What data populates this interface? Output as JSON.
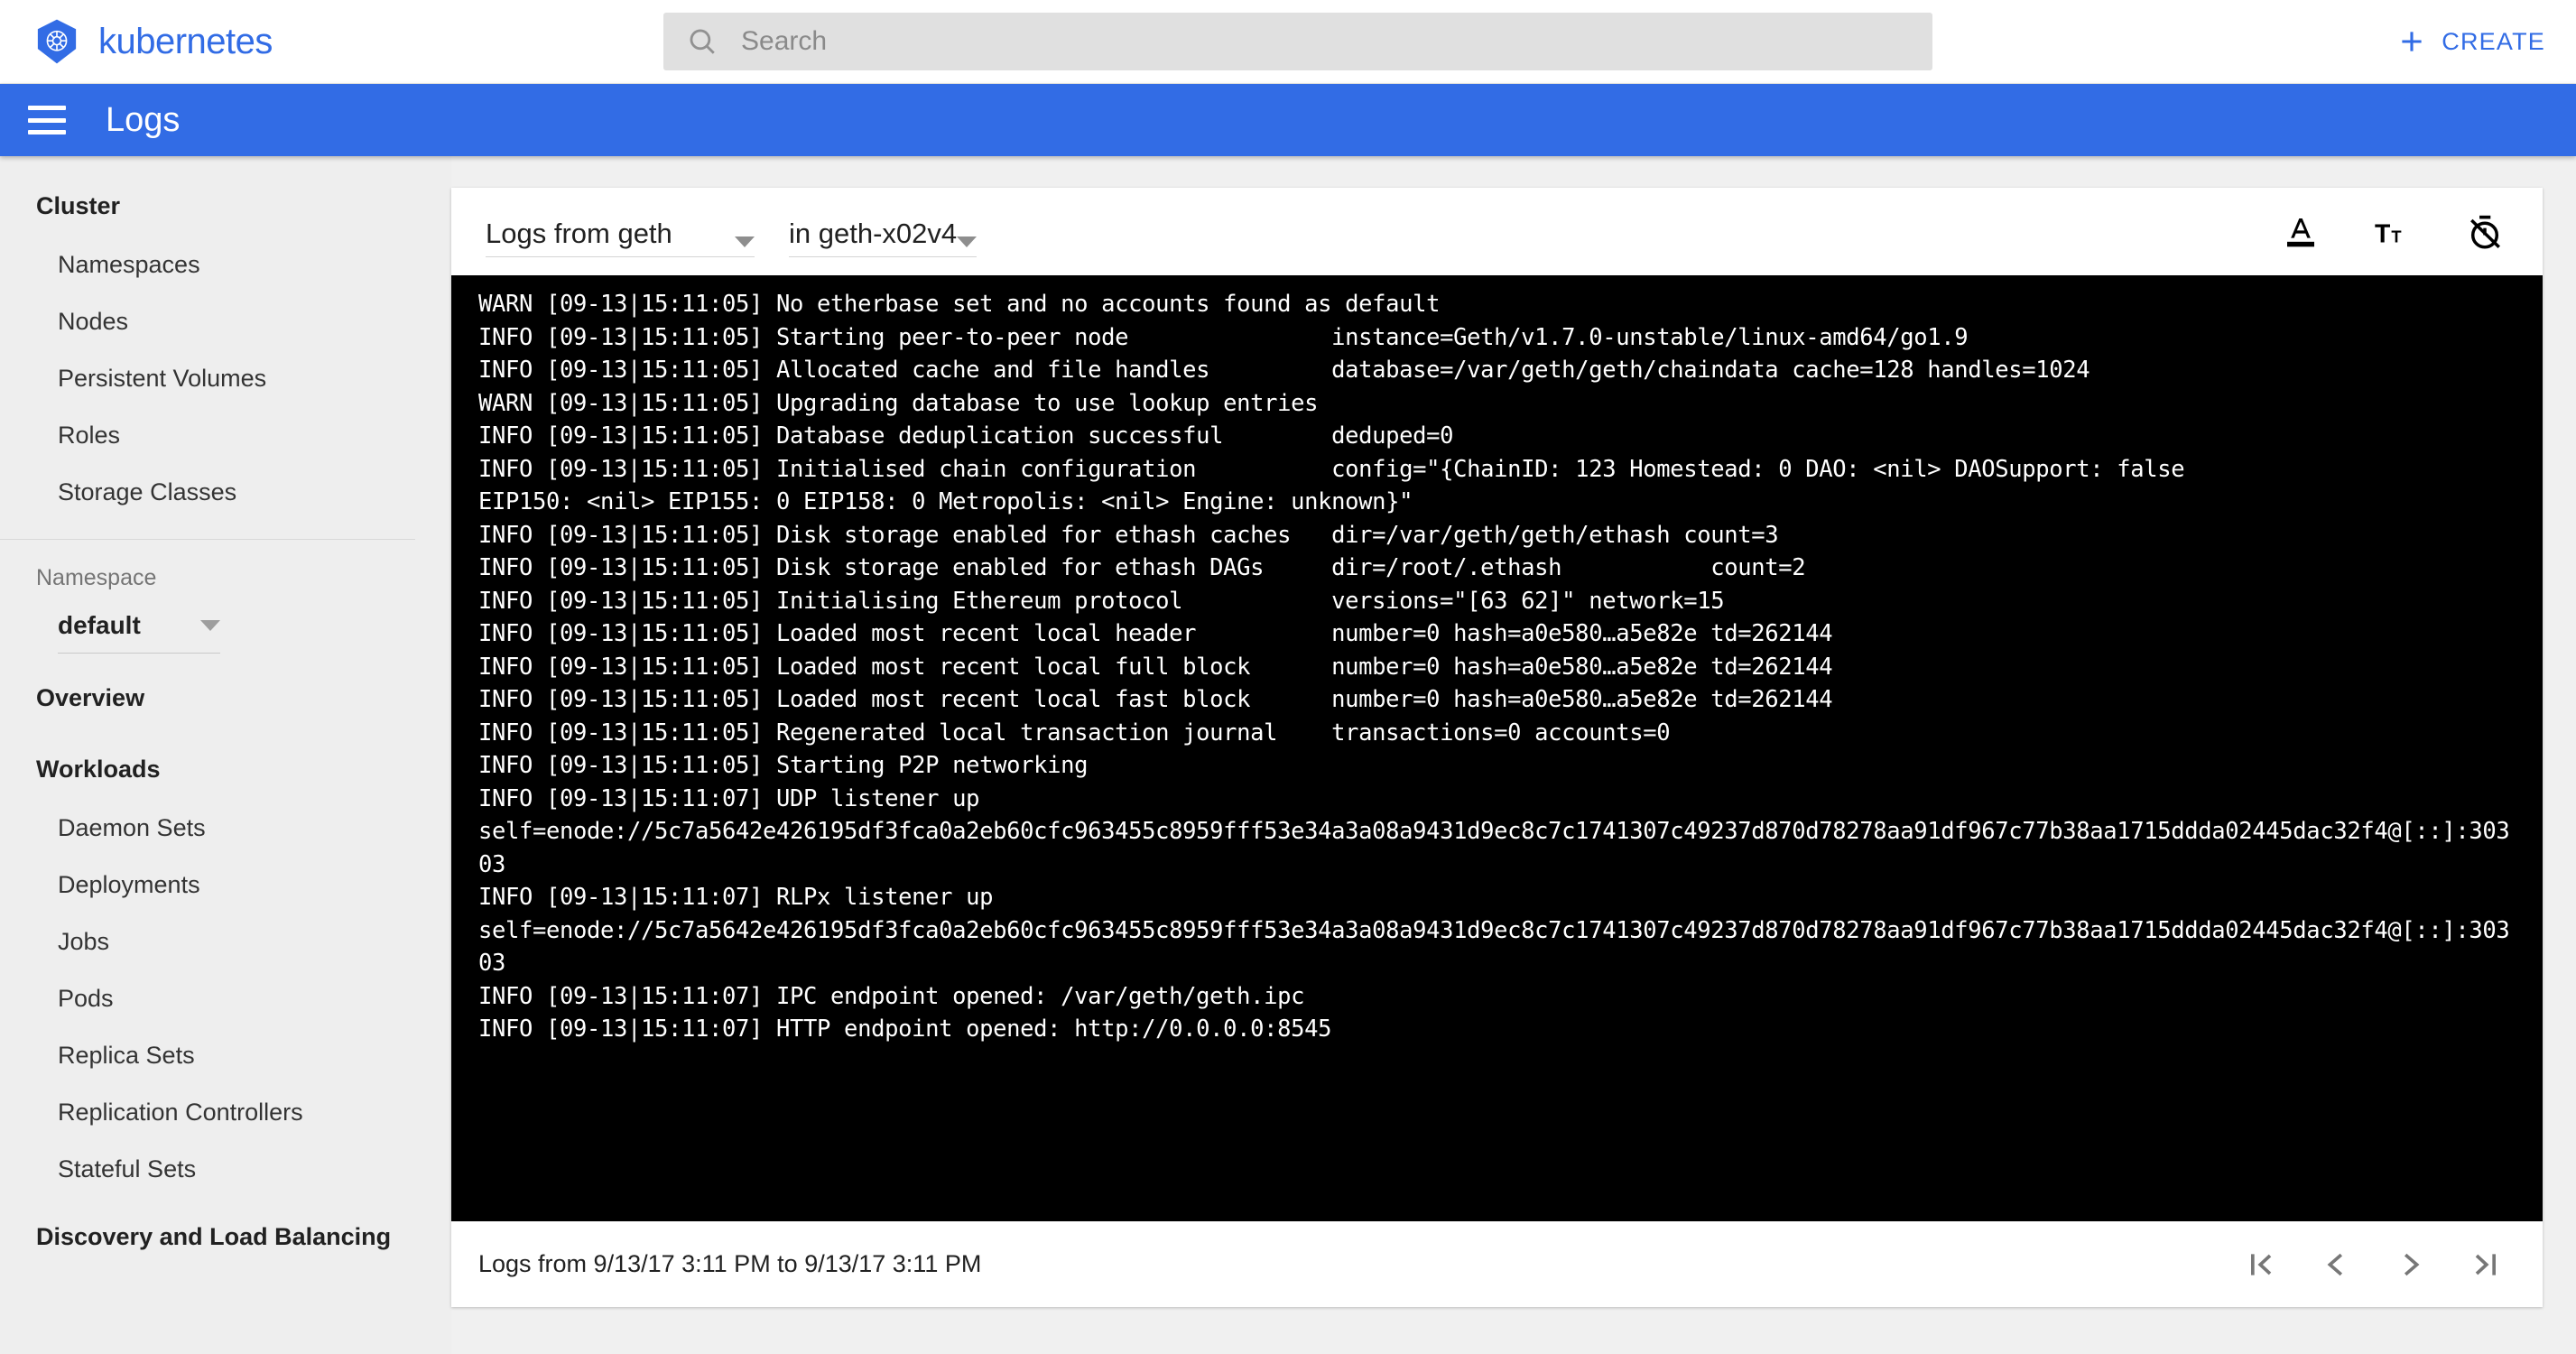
{
  "topbar": {
    "brand": "kubernetes",
    "brand_color": "#326ce5",
    "search_placeholder": "Search",
    "search_value": "",
    "create_label": "CREATE"
  },
  "actionbar": {
    "title": "Logs"
  },
  "sidebar": {
    "groups": [
      {
        "header": "Cluster",
        "items": [
          "Namespaces",
          "Nodes",
          "Persistent Volumes",
          "Roles",
          "Storage Classes"
        ]
      }
    ],
    "namespace_label": "Namespace",
    "namespace_value": "default",
    "overview": "Overview",
    "workloads_header": "Workloads",
    "workloads_items": [
      "Daemon Sets",
      "Deployments",
      "Jobs",
      "Pods",
      "Replica Sets",
      "Replication Controllers",
      "Stateful Sets"
    ],
    "discovery_header": "Discovery and Load Balancing"
  },
  "logs_card": {
    "container_select": "Logs from geth",
    "pod_prefix": "in",
    "pod_select": "in geth-x02v4",
    "toolbar_icons": [
      "format-color-text-icon",
      "format-size-icon",
      "timer-off-icon"
    ],
    "footer_text": "Logs from 9/13/17 3:11 PM to 9/13/17 3:11 PM",
    "pager_icons": [
      "first-page-icon",
      "previous-page-icon",
      "next-page-icon",
      "last-page-icon"
    ],
    "background_color": "#000000",
    "text_color": "#ffffff",
    "lines": [
      "WARN [09-13|15:11:05] No etherbase set and no accounts found as default",
      "INFO [09-13|15:11:05] Starting peer-to-peer node               instance=Geth/v1.7.0-unstable/linux-amd64/go1.9",
      "INFO [09-13|15:11:05] Allocated cache and file handles         database=/var/geth/geth/chaindata cache=128 handles=1024",
      "WARN [09-13|15:11:05] Upgrading database to use lookup entries",
      "INFO [09-13|15:11:05] Database deduplication successful        deduped=0",
      "INFO [09-13|15:11:05] Initialised chain configuration          config=\"{ChainID: 123 Homestead: 0 DAO: <nil> DAOSupport: false",
      "EIP150: <nil> EIP155: 0 EIP158: 0 Metropolis: <nil> Engine: unknown}\"",
      "INFO [09-13|15:11:05] Disk storage enabled for ethash caches   dir=/var/geth/geth/ethash count=3",
      "INFO [09-13|15:11:05] Disk storage enabled for ethash DAGs     dir=/root/.ethash           count=2",
      "INFO [09-13|15:11:05] Initialising Ethereum protocol           versions=\"[63 62]\" network=15",
      "INFO [09-13|15:11:05] Loaded most recent local header          number=0 hash=a0e580…a5e82e td=262144",
      "INFO [09-13|15:11:05] Loaded most recent local full block      number=0 hash=a0e580…a5e82e td=262144",
      "INFO [09-13|15:11:05] Loaded most recent local fast block      number=0 hash=a0e580…a5e82e td=262144",
      "INFO [09-13|15:11:05] Regenerated local transaction journal    transactions=0 accounts=0",
      "INFO [09-13|15:11:05] Starting P2P networking",
      "INFO [09-13|15:11:07] UDP listener up",
      "self=enode://5c7a5642e426195df3fca0a2eb60cfc963455c8959fff53e34a3a08a9431d9ec8c7c1741307c49237d870d78278aa91df967c77b38aa1715ddda02445dac32f4@[::]:30303",
      "INFO [09-13|15:11:07] RLPx listener up",
      "self=enode://5c7a5642e426195df3fca0a2eb60cfc963455c8959fff53e34a3a08a9431d9ec8c7c1741307c49237d870d78278aa91df967c77b38aa1715ddda02445dac32f4@[::]:30303",
      "INFO [09-13|15:11:07] IPC endpoint opened: /var/geth/geth.ipc",
      "INFO [09-13|15:11:07] HTTP endpoint opened: http://0.0.0.0:8545"
    ]
  }
}
